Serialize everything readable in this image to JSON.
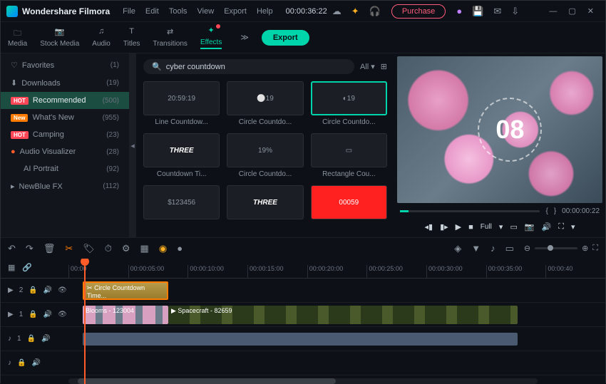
{
  "app": {
    "title": "Wondershare Filmora"
  },
  "menu": [
    "File",
    "Edit",
    "Tools",
    "View",
    "Export",
    "Help"
  ],
  "timecode": "00:00:36:22",
  "purchase_label": "Purchase",
  "toolbar": {
    "tabs": [
      {
        "label": "Media"
      },
      {
        "label": "Stock Media"
      },
      {
        "label": "Audio"
      },
      {
        "label": "Titles"
      },
      {
        "label": "Transitions"
      },
      {
        "label": "Effects"
      }
    ],
    "export_label": "Export"
  },
  "sidebar": [
    {
      "icon": "♡",
      "label": "Favorites",
      "count": "(1)"
    },
    {
      "icon": "⬇",
      "label": "Downloads",
      "count": "(19)"
    },
    {
      "badge": "HOT",
      "label": "Recommended",
      "count": "(500)",
      "sel": true
    },
    {
      "badge": "New",
      "badgeClass": "new",
      "label": "What's New",
      "count": "(955)"
    },
    {
      "badge": "HOT",
      "label": "Camping",
      "count": "(23)"
    },
    {
      "dot": "#ff5c2a",
      "label": "Audio Visualizer",
      "count": "(28)"
    },
    {
      "label": "AI Portrait",
      "count": "(92)"
    },
    {
      "icon": "▸",
      "label": "NewBlue FX",
      "count": "(112)"
    }
  ],
  "search": {
    "placeholder": "",
    "value": "cyber countdown",
    "filter": "All"
  },
  "effects": [
    {
      "label": "Line Countdow...",
      "preview": "20:59:19"
    },
    {
      "label": "Circle Countdo...",
      "preview": "⚪19"
    },
    {
      "label": "Circle Countdo...",
      "preview": "◐19",
      "sel": true
    },
    {
      "label": "Countdown Ti...",
      "preview": "THREE"
    },
    {
      "label": "Circle Countdo...",
      "preview": "19%"
    },
    {
      "label": "Rectangle Cou...",
      "preview": "▭"
    },
    {
      "label": "",
      "preview": "$123456"
    },
    {
      "label": "",
      "preview": "THREE"
    },
    {
      "label": "",
      "preview": "00059"
    }
  ],
  "preview": {
    "counter": "08",
    "time": "00:00:00:22",
    "quality": "Full"
  },
  "ruler": [
    "00:00",
    "00:00:05:00",
    "00:00:10:00",
    "00:00:15:00",
    "00:00:20:00",
    "00:00:25:00",
    "00:00:30:00",
    "00:00:35:00",
    "00:00:40"
  ],
  "tracks": {
    "t2_label": "2",
    "t1_label": "1",
    "a1_label": "1",
    "effect_clip": "Circle Countdown Time...",
    "video1_clip": "Blooms - 123004",
    "video2_clip": "Spacecraft - 82659"
  }
}
